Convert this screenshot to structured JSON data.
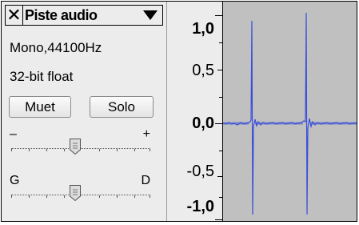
{
  "track": {
    "close_glyph": "✕",
    "name": "Piste audio",
    "format": "Mono,44100Hz",
    "bitdepth": "32-bit float",
    "mute_label": "Muet",
    "solo_label": "Solo",
    "gain": {
      "minus": "–",
      "plus": "+",
      "level": 0.45
    },
    "pan": {
      "left": "G",
      "right": "D",
      "level": 0.45
    }
  },
  "ruler": {
    "ticks": [
      "1,0",
      "0,5",
      "0,0",
      "-0,5",
      "-1,0"
    ]
  },
  "colors": {
    "waveform": "#3a4fd8",
    "background": "#c0c0c0",
    "panel": "#ececec"
  }
}
